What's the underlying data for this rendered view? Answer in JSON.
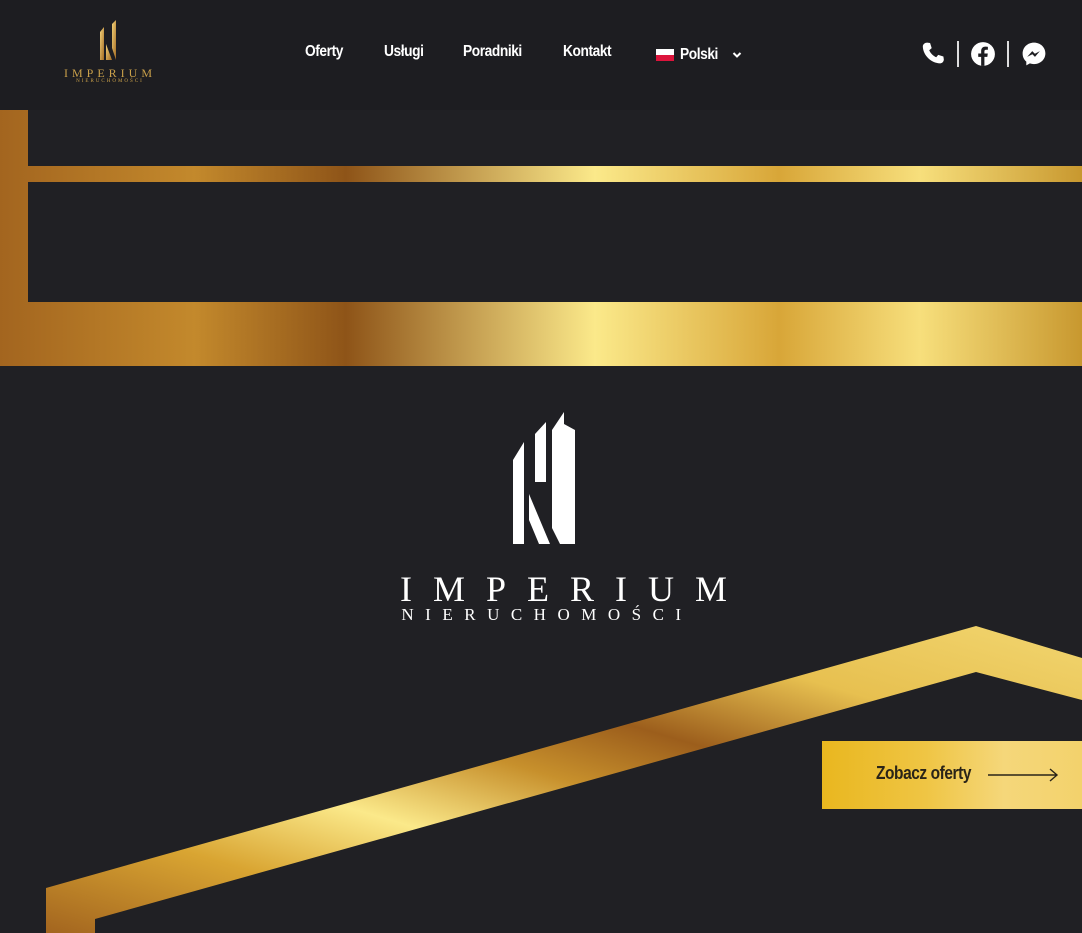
{
  "header": {
    "logo": {
      "word": "IMPERIUM",
      "sub": "NIERUCHOMOŚCI"
    },
    "nav": [
      {
        "label": "Oferty"
      },
      {
        "label": "Usługi"
      },
      {
        "label": "Poradniki"
      },
      {
        "label": "Kontakt"
      }
    ],
    "language": {
      "label": "Polski"
    },
    "social": {
      "icons": [
        "phone-icon",
        "facebook-icon",
        "messenger-icon"
      ]
    }
  },
  "hero": {
    "logo": {
      "word": "IMPERIUM",
      "sub": "NIERUCHOMOŚCI"
    },
    "cta_label": "Zobacz oferty"
  },
  "colors": {
    "background": "#202024",
    "header_bg": "#1d1d21",
    "gold_dark": "#a3651f",
    "gold_light": "#fbe98a",
    "cta_gold": "#efc544",
    "text": "#ffffff"
  }
}
